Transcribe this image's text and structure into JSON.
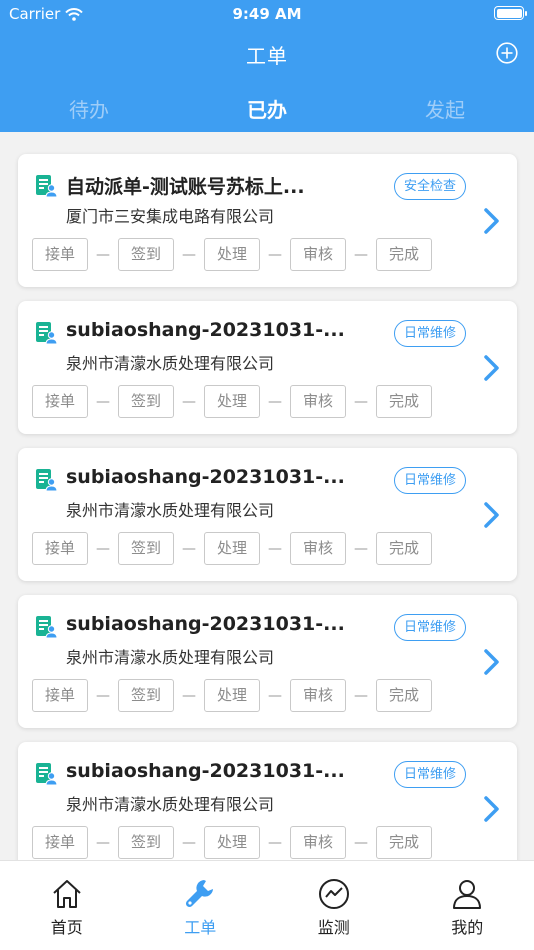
{
  "status_bar": {
    "carrier": "Carrier",
    "time": "9:49 AM"
  },
  "header": {
    "title": "工单",
    "add_icon": "plus-circle-icon"
  },
  "tabs": [
    {
      "label": "待办",
      "active": false
    },
    {
      "label": "已办",
      "active": true
    },
    {
      "label": "发起",
      "active": false
    }
  ],
  "work_orders": [
    {
      "title": "自动派单-测试账号苏标上...",
      "company": "厦门市三安集成电路有限公司",
      "tag": "安全检查",
      "steps": [
        "接单",
        "签到",
        "处理",
        "审核",
        "完成"
      ]
    },
    {
      "title": "subiaoshang-20231031-...",
      "company": "泉州市清濛水质处理有限公司",
      "tag": "日常维修",
      "steps": [
        "接单",
        "签到",
        "处理",
        "审核",
        "完成"
      ]
    },
    {
      "title": "subiaoshang-20231031-...",
      "company": "泉州市清濛水质处理有限公司",
      "tag": "日常维修",
      "steps": [
        "接单",
        "签到",
        "处理",
        "审核",
        "完成"
      ]
    },
    {
      "title": "subiaoshang-20231031-...",
      "company": "泉州市清濛水质处理有限公司",
      "tag": "日常维修",
      "steps": [
        "接单",
        "签到",
        "处理",
        "审核",
        "完成"
      ]
    },
    {
      "title": "subiaoshang-20231031-...",
      "company": "泉州市清濛水质处理有限公司",
      "tag": "日常维修",
      "steps": [
        "接单",
        "签到",
        "处理",
        "审核",
        "完成"
      ]
    }
  ],
  "step_separator": "—",
  "tabbar": [
    {
      "label": "首页",
      "icon": "home-icon",
      "active": false
    },
    {
      "label": "工单",
      "icon": "wrench-icon",
      "active": true
    },
    {
      "label": "监测",
      "icon": "monitor-chart-icon",
      "active": false
    },
    {
      "label": "我的",
      "icon": "user-icon",
      "active": false
    }
  ],
  "colors": {
    "primary": "#3e9ef2",
    "icon_green": "#19b394",
    "background": "#f2f2f2"
  }
}
